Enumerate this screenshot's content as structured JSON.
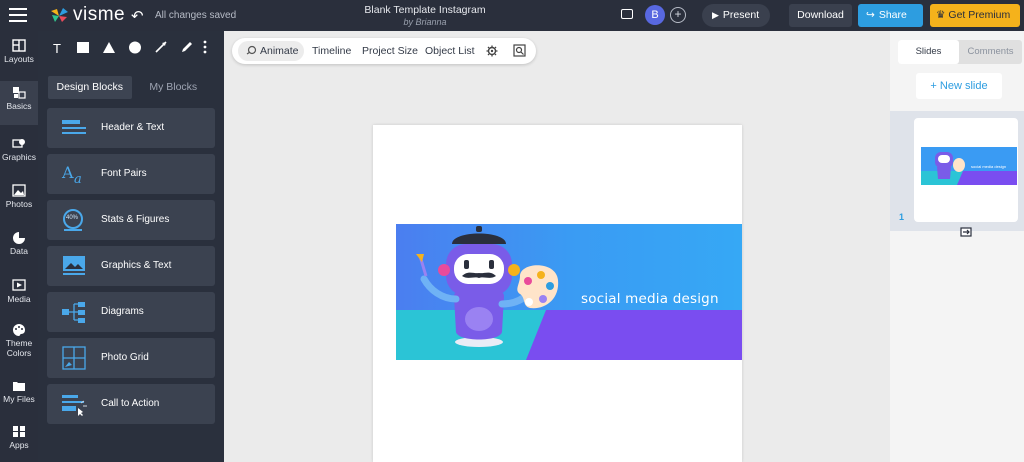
{
  "header": {
    "app_name": "visme",
    "save_status": "All changes saved",
    "doc_title": "Blank Template Instagram",
    "doc_author": "by Brianna",
    "user_initial": "B",
    "present_label": "Present",
    "download_label": "Download",
    "share_label": "Share",
    "premium_label": "Get Premium"
  },
  "rail": {
    "items": [
      {
        "label": "Layouts",
        "icon": "layouts-icon"
      },
      {
        "label": "Basics",
        "icon": "basics-icon"
      },
      {
        "label": "Graphics",
        "icon": "graphics-icon"
      },
      {
        "label": "Photos",
        "icon": "photos-icon"
      },
      {
        "label": "Data",
        "icon": "data-icon"
      },
      {
        "label": "Media",
        "icon": "media-icon"
      },
      {
        "label": "Theme",
        "label2": "Colors",
        "icon": "palette-icon"
      },
      {
        "label": "My Files",
        "icon": "folder-icon"
      },
      {
        "label": "Apps",
        "icon": "apps-icon"
      }
    ]
  },
  "panel": {
    "tools": [
      "T"
    ],
    "tabs": [
      "Design Blocks",
      "My Blocks"
    ],
    "blocks": [
      {
        "label": "Header & Text"
      },
      {
        "label": "Font Pairs"
      },
      {
        "label": "Stats & Figures",
        "badge": "40%"
      },
      {
        "label": "Graphics & Text"
      },
      {
        "label": "Diagrams"
      },
      {
        "label": "Photo Grid"
      },
      {
        "label": "Call to Action"
      }
    ]
  },
  "canvas_toolbar": {
    "animate": "Animate",
    "timeline": "Timeline",
    "project_size": "Project Size",
    "object_list": "Object List"
  },
  "banner": {
    "text": "social media design"
  },
  "right_panel": {
    "tab_slides": "Slides",
    "tab_comments": "Comments",
    "new_slide": "+ New slide",
    "slide_number": "1",
    "thumb_text": "social media design"
  },
  "colors": {
    "topbar": "#2a2f3c",
    "accent_blue": "#2d9de0",
    "premium": "#f5b21b",
    "banner_blue": "#3aa0f2",
    "banner_purple": "#7a4df0",
    "banner_teal": "#2bc4d6"
  }
}
